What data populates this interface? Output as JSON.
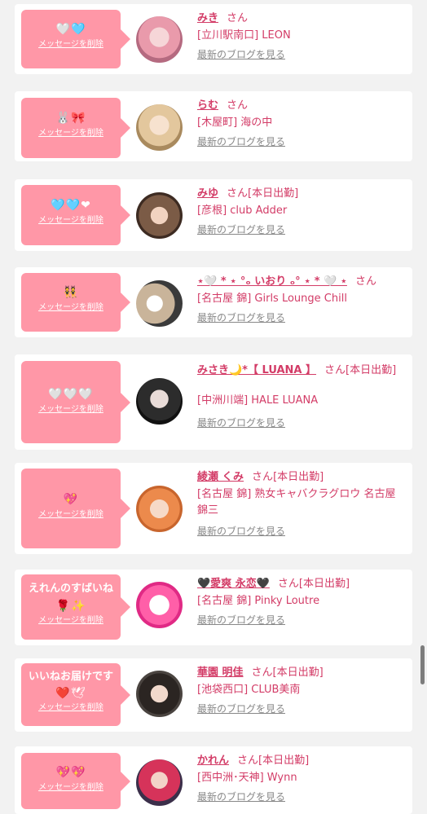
{
  "common": {
    "delete_label": "メッセージを削除",
    "san": "さん",
    "blog_label": "最新のブログを見る"
  },
  "colors": {
    "bubble": "#ff97a7",
    "accent": "#d33c67",
    "background": "#f2f2f2"
  },
  "cards": [
    {
      "bubble_text": "",
      "emoji": "🤍🩵",
      "name": "みき",
      "status": "",
      "shop": "[立川駅南口] LEON",
      "avatar_icon": "girl-pink-hair-avatar"
    },
    {
      "bubble_text": "",
      "emoji": "🐰🎀",
      "name": "らむ",
      "status": "",
      "shop": "[木屋町] 海の中",
      "avatar_icon": "girl-blonde-avatar"
    },
    {
      "bubble_text": "",
      "emoji": "🩵🩵❤",
      "name": "みゆ",
      "status": "[本日出勤]",
      "shop": "[彦根] club Adder",
      "avatar_icon": "girl-brown-hair-avatar"
    },
    {
      "bubble_text": "",
      "emoji": "👯",
      "name": "⋆🤍 * ⋆ °ₒ いおり ₒ° ⋆ * 🤍 ⋆",
      "status": "",
      "shop": "[名古屋 錦] Girls Lounge Chill",
      "avatar_icon": "two-girls-avatar"
    },
    {
      "bubble_text": "",
      "emoji": "🤍🤍🤍",
      "name": "みさき🌙*【 LUANA 】",
      "status": "[本日出勤]",
      "shop": "[中洲川端] HALE LUANA",
      "avatar_icon": "girl-dark-avatar"
    },
    {
      "bubble_text": "",
      "emoji": "💖",
      "name": "綾瀬 くみ",
      "status": "[本日出勤]",
      "shop": "[名古屋 錦] 熟女キャバクラグロウ 名古屋錦三",
      "avatar_icon": "girl-orange-hair-avatar"
    },
    {
      "bubble_text": "えれんのすばいね",
      "emoji": "🌹✨",
      "name": "🖤愛爽 永恋🖤",
      "status": "[本日出勤]",
      "shop": "[名古屋 錦] Pinky Loutre",
      "avatar_icon": "girl-pink-poster-avatar"
    },
    {
      "bubble_text": "いいねお届けです",
      "emoji": "❤️🕊",
      "name": "華園 明佳",
      "status": "[本日出勤]",
      "shop": "[池袋西口] CLUB美南",
      "avatar_icon": "girl-black-hair-avatar"
    },
    {
      "bubble_text": "",
      "emoji": "💖💖",
      "name": "かれん",
      "status": "[本日出勤]",
      "shop": "[西中洲･天神] Wynn",
      "avatar_icon": "girl-red-dress-avatar"
    }
  ]
}
